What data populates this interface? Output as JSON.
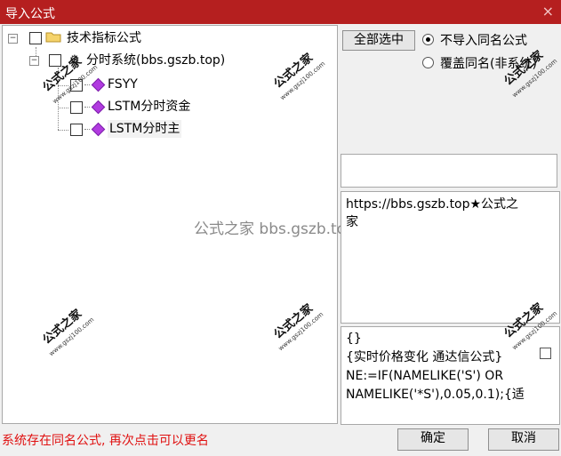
{
  "window": {
    "title": "导入公式",
    "close_icon": "×"
  },
  "tree": {
    "root": {
      "label": "技术指标公式"
    },
    "group": {
      "label": "分时系统(bbs.gszb.top)"
    },
    "items": [
      {
        "label": "FSYY"
      },
      {
        "label": "LSTM分时资金"
      },
      {
        "label": "LSTM分时主"
      }
    ]
  },
  "controls": {
    "select_all_label": "全部选中",
    "radio_skip_label": "不导入同名公式",
    "radio_overwrite_label": "覆盖同名(非系统)",
    "selected_radio": "skip"
  },
  "info": {
    "text_line1": "https://bbs.gszb.top★公式之",
    "text_line2": "家"
  },
  "source": {
    "line1": "{}",
    "line2": "{实时价格变化 通达信公式}",
    "line3": "NE:=IF(NAMELIKE('S') OR",
    "line4": "NAMELIKE('*S'),0.05,0.1);{适"
  },
  "footer": {
    "status_text": "系统存在同名公式, 再次点击可以更名",
    "ok_label": "确定",
    "cancel_label": "取消"
  },
  "watermark": {
    "brand": "公式之家",
    "url": "www.gszj100.com",
    "center_text": "公式之家 bbs.gszb.top"
  },
  "colors": {
    "titlebar": "#b51f1f",
    "status_text": "#e01010",
    "item_icon": "#b13be0"
  }
}
